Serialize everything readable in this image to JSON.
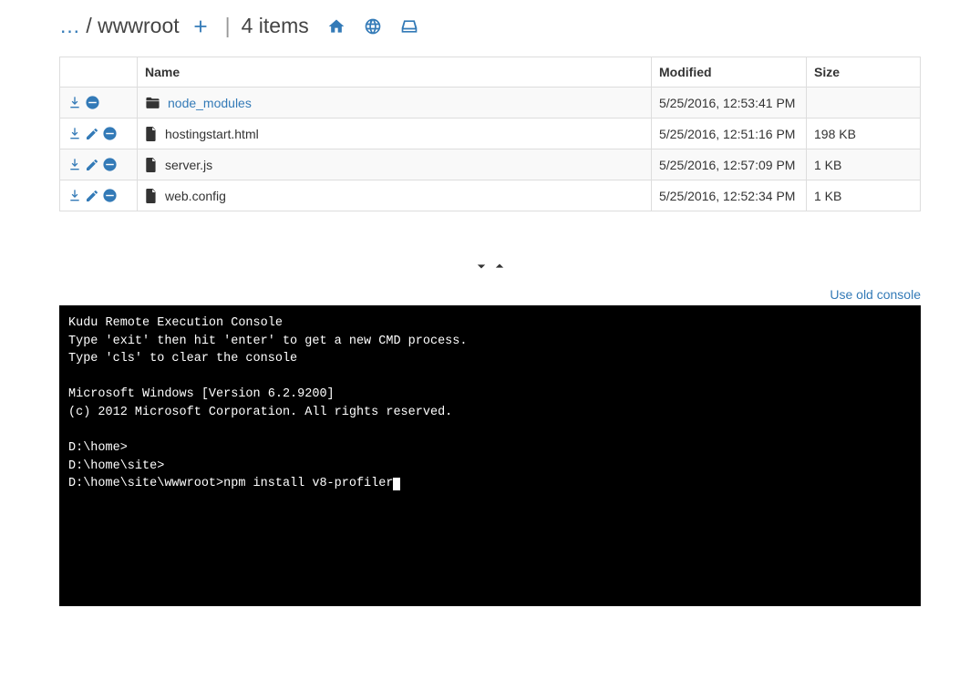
{
  "breadcrumb": {
    "ellipsis": "…",
    "sep": "/",
    "current": "wwwroot",
    "items_label": "4 items"
  },
  "table": {
    "headers": {
      "name": "Name",
      "modified": "Modified",
      "size": "Size"
    },
    "rows": [
      {
        "type": "folder",
        "name": "node_modules",
        "modified": "5/25/2016, 12:53:41 PM",
        "size": ""
      },
      {
        "type": "file",
        "name": "hostingstart.html",
        "modified": "5/25/2016, 12:51:16 PM",
        "size": "198 KB"
      },
      {
        "type": "file",
        "name": "server.js",
        "modified": "5/25/2016, 12:57:09 PM",
        "size": "1 KB"
      },
      {
        "type": "file",
        "name": "web.config",
        "modified": "5/25/2016, 12:52:34 PM",
        "size": "1 KB"
      }
    ]
  },
  "console_link": "Use old console",
  "console": {
    "lines": [
      "Kudu Remote Execution Console",
      "Type 'exit' then hit 'enter' to get a new CMD process.",
      "Type 'cls' to clear the console",
      "",
      "Microsoft Windows [Version 6.2.9200]",
      "(c) 2012 Microsoft Corporation. All rights reserved.",
      "",
      "D:\\home>",
      "D:\\home\\site>"
    ],
    "prompt": "D:\\home\\site\\wwwroot>",
    "command": "npm install v8-profiler"
  }
}
